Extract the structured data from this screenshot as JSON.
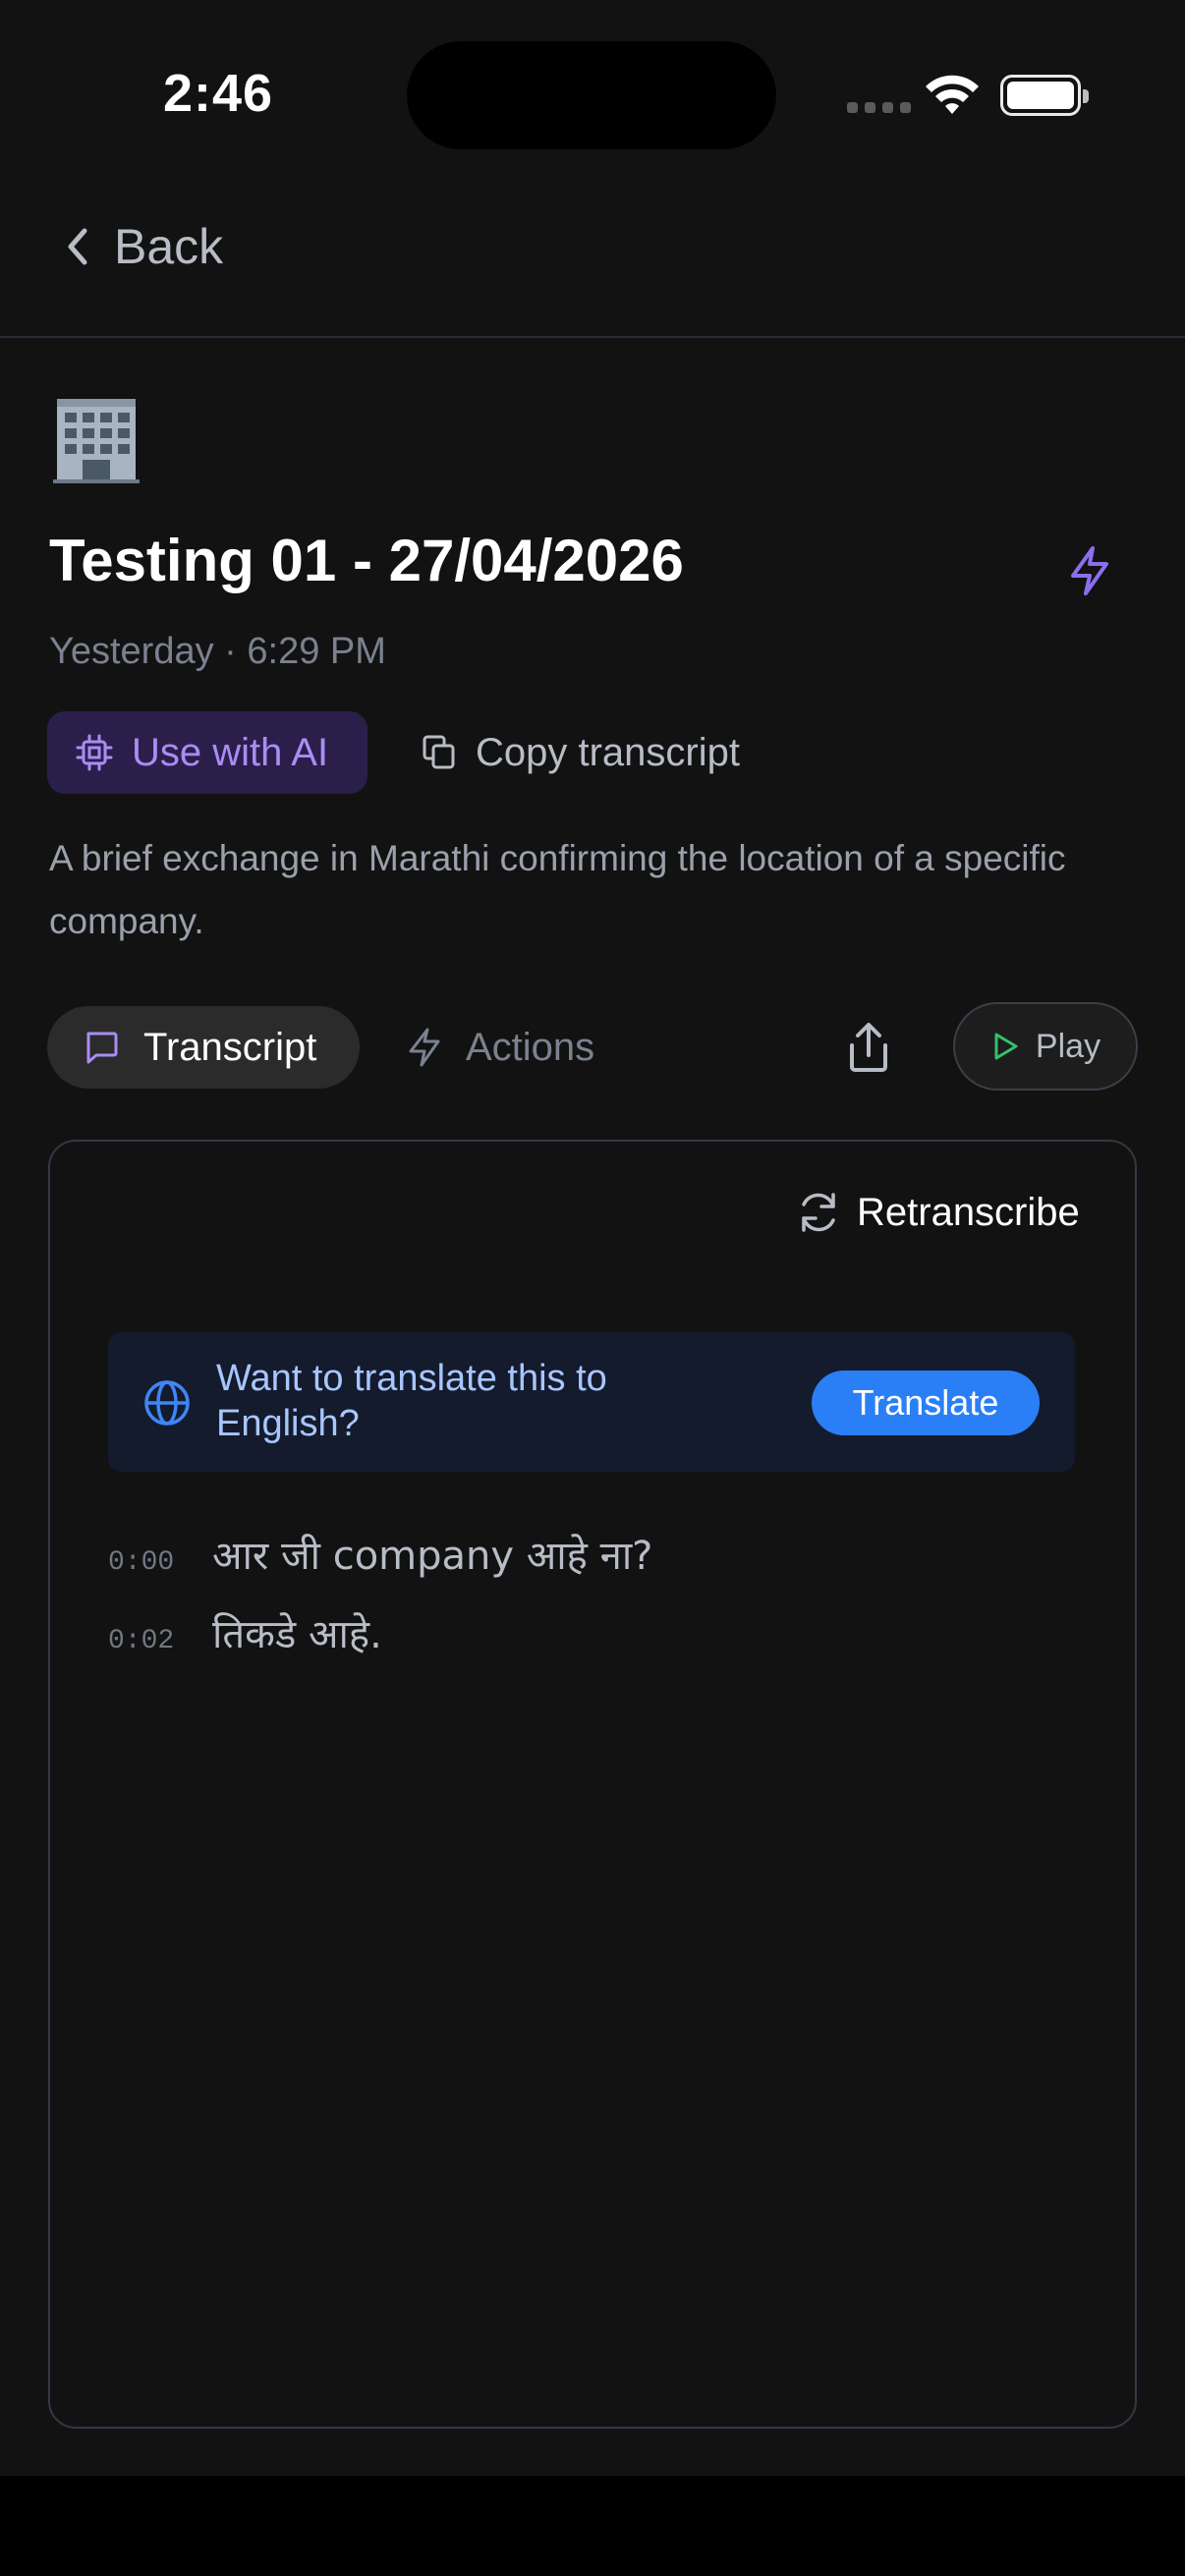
{
  "status_bar": {
    "time": "2:46"
  },
  "nav": {
    "back_label": "Back"
  },
  "recording": {
    "emoji": "🏢",
    "title": "Testing 01 - 27/04/2026",
    "meta": "Yesterday · 6:29 PM",
    "summary": "A brief exchange in Marathi confirming the location of a specific company."
  },
  "actions": {
    "use_ai_label": "Use with AI",
    "copy_label": "Copy transcript"
  },
  "tabs": {
    "transcript_label": "Transcript",
    "actions_label": "Actions",
    "active": "Transcript"
  },
  "player": {
    "play_label": "Play"
  },
  "card": {
    "retranscribe_label": "Retranscribe",
    "translate_prompt": "Want to translate this to English?",
    "translate_button": "Translate",
    "lines": [
      {
        "time": "0:00",
        "text": "आर जी company आहे ना?"
      },
      {
        "time": "0:02",
        "text": "तिकडे आहे."
      }
    ]
  },
  "colors": {
    "background": "#121212",
    "accent_purple": "#a98cf5",
    "accent_blue": "#2b7ff6",
    "play_green": "#35c06a"
  }
}
